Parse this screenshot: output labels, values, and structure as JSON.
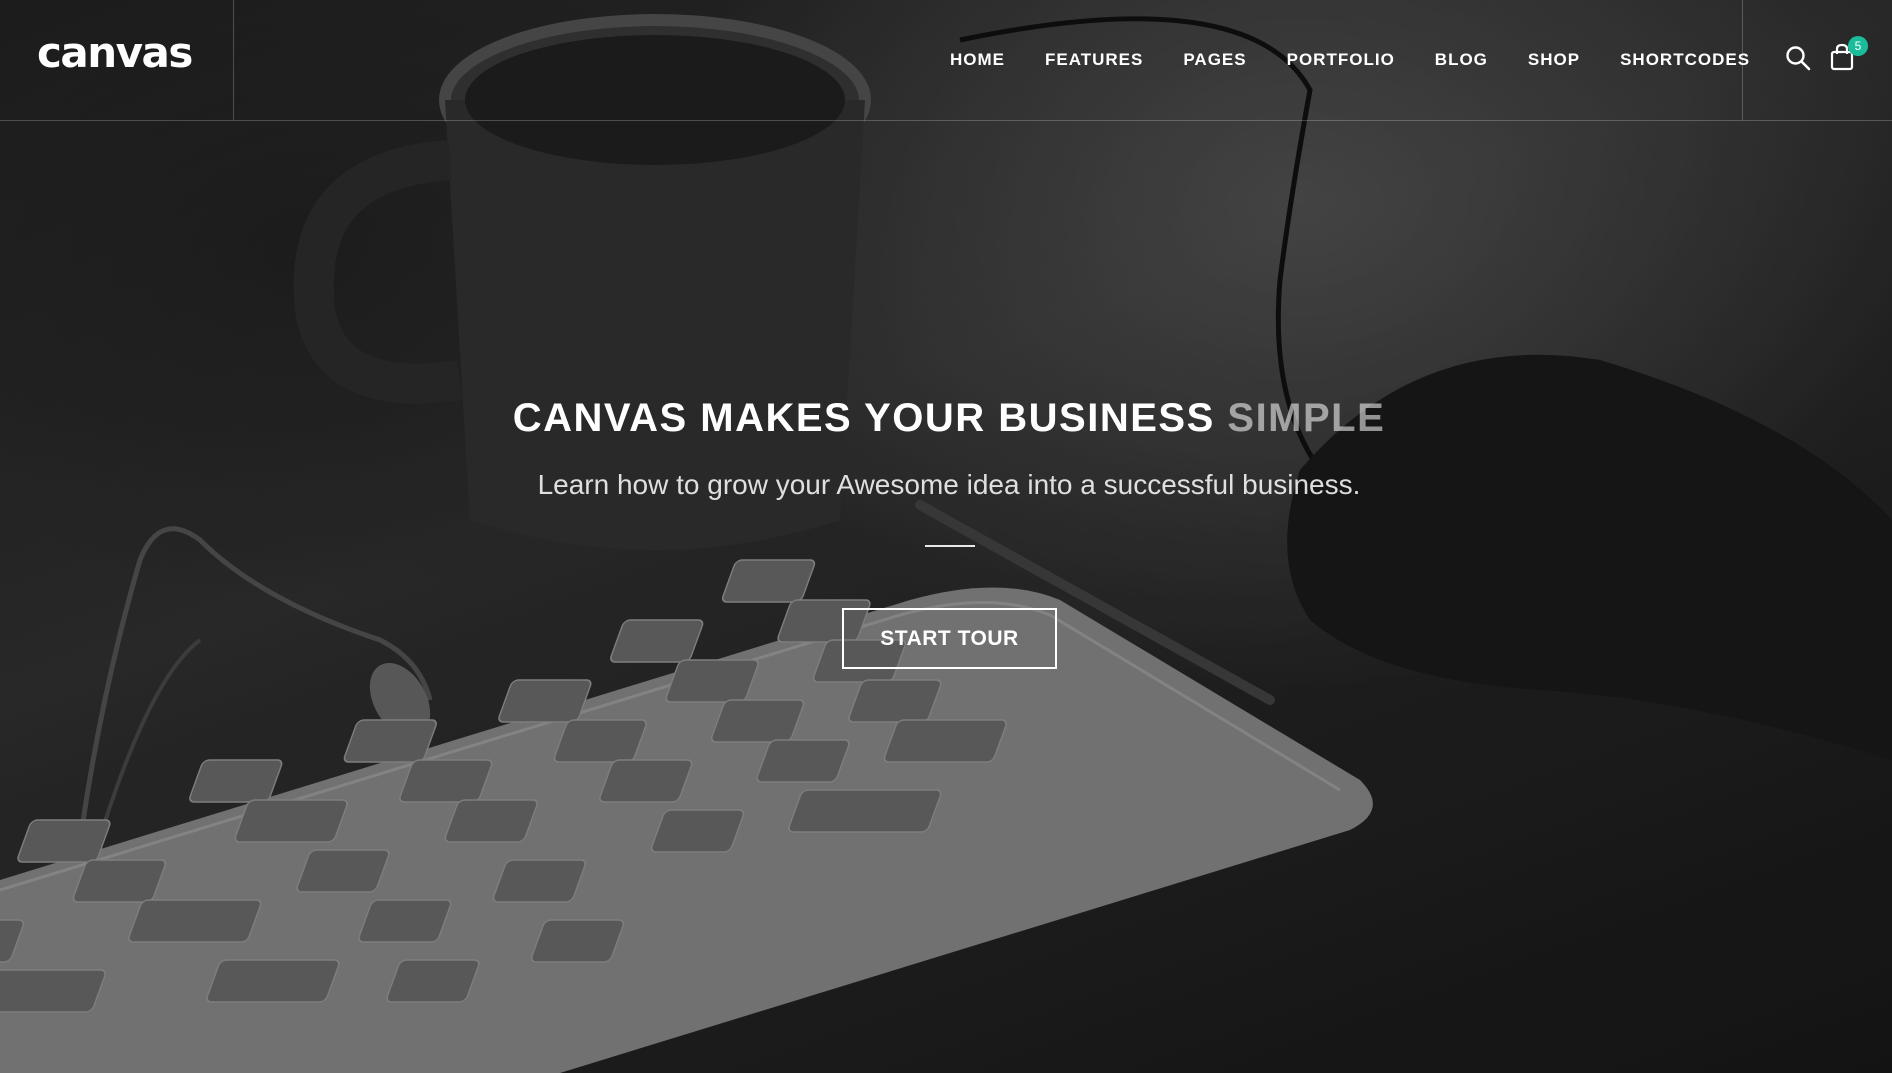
{
  "brand": {
    "logo_text": "canvas"
  },
  "nav": {
    "items": [
      {
        "label": "HOME"
      },
      {
        "label": "FEATURES"
      },
      {
        "label": "PAGES"
      },
      {
        "label": "PORTFOLIO"
      },
      {
        "label": "BLOG"
      },
      {
        "label": "SHOP"
      },
      {
        "label": "SHORTCODES"
      }
    ]
  },
  "tools": {
    "search_icon": "search-icon",
    "cart_icon": "shopping-bag-icon",
    "cart_count": "5"
  },
  "hero": {
    "headline_main": "CANVAS MAKES YOUR BUSINESS ",
    "headline_accent": "SIMPLE",
    "subline": "Learn how to grow your Awesome idea into a successful business.",
    "cta_label": "START TOUR"
  },
  "colors": {
    "accent": "#1abc9c",
    "text": "#ffffff"
  }
}
